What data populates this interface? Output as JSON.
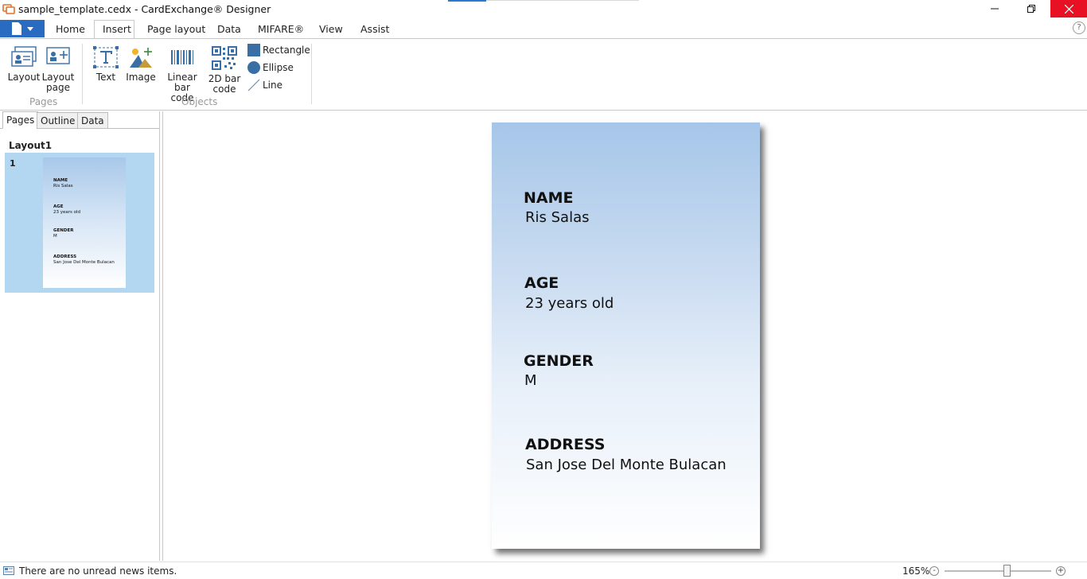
{
  "window": {
    "title": "sample_template.cedx - CardExchange® Designer",
    "app_icon": "cardexchange-logo-icon"
  },
  "ribbon": {
    "file_icon": "document-icon",
    "tabs": [
      "Home",
      "Insert",
      "Page layout",
      "Data",
      "MIFARE®",
      "View",
      "Assist"
    ],
    "active_tab": "Insert",
    "groups": {
      "pages": {
        "label": "Pages",
        "buttons": [
          {
            "label_line1": "Layout",
            "label_line2": "",
            "icon": "layout-icon"
          },
          {
            "label_line1": "Layout",
            "label_line2": "page",
            "icon": "layout-page-icon"
          }
        ]
      },
      "objects": {
        "label": "Objects",
        "buttons": [
          {
            "label_line1": "Text",
            "label_line2": "",
            "icon": "text-icon"
          },
          {
            "label_line1": "Image",
            "label_line2": "",
            "icon": "image-icon"
          },
          {
            "label_line1": "Linear bar",
            "label_line2": "code",
            "icon": "barcode-icon"
          },
          {
            "label_line1": "2D bar",
            "label_line2": "code",
            "icon": "qrcode-icon"
          }
        ],
        "shapes": [
          "Rectangle",
          "Ellipse",
          "Line"
        ]
      }
    }
  },
  "left_panel": {
    "tabs": [
      "Pages",
      "Outline",
      "Data"
    ],
    "active_tab": "Pages",
    "layout_name": "Layout1",
    "page_number": "1"
  },
  "card": {
    "fields": [
      {
        "label": "NAME",
        "value": "Ris Salas"
      },
      {
        "label": "AGE",
        "value": "23 years old"
      },
      {
        "label": "GENDER",
        "value": "M"
      },
      {
        "label": "ADDRESS",
        "value": "San Jose Del Monte Bulacan"
      }
    ],
    "gradient_top": "#a6c6e9",
    "gradient_bottom": "#ffffff"
  },
  "status": {
    "news_text": "There are no unread news items.",
    "zoom": "165%",
    "zoom_out_symbol": "-",
    "zoom_in_symbol": "+"
  },
  "colors": {
    "accent": "#2a6bc2",
    "close_button": "#e81123",
    "selection": "#b3d7f0"
  }
}
